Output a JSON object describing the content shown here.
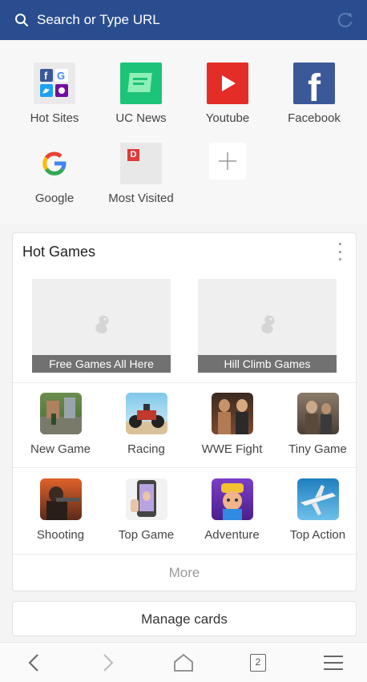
{
  "topbar": {
    "placeholder": "Search or Type URL",
    "search_icon": "search-icon",
    "refresh_icon": "refresh-icon"
  },
  "speed_dial": [
    {
      "label": "Hot Sites",
      "icon": "hot-sites-icon"
    },
    {
      "label": "UC News",
      "icon": "uc-news-icon"
    },
    {
      "label": "Youtube",
      "icon": "youtube-icon"
    },
    {
      "label": "Facebook",
      "icon": "facebook-icon"
    },
    {
      "label": "Google",
      "icon": "google-icon"
    },
    {
      "label": "Most Visited",
      "icon": "most-visited-icon",
      "badge": "D"
    },
    {
      "label": "",
      "icon": "add-icon"
    }
  ],
  "hot_games": {
    "title": "Hot Games",
    "banners": [
      "Free Games All Here",
      "Hill Climb Games"
    ],
    "games": [
      {
        "label": "New Game",
        "icon": "new-game-icon"
      },
      {
        "label": "Racing",
        "icon": "racing-icon"
      },
      {
        "label": "WWE Fight",
        "icon": "wwe-fight-icon"
      },
      {
        "label": "Tiny Game",
        "icon": "tiny-game-icon"
      },
      {
        "label": "Shooting",
        "icon": "shooting-icon"
      },
      {
        "label": "Top Game",
        "icon": "top-game-icon"
      },
      {
        "label": "Adventure",
        "icon": "adventure-icon"
      },
      {
        "label": "Top Action",
        "icon": "top-action-icon"
      }
    ],
    "more_label": "More"
  },
  "manage_cards": {
    "label": "Manage cards"
  },
  "bottom_nav": {
    "tab_count": "2"
  },
  "colors": {
    "topbar": "#2a4d8f",
    "youtube": "#e52d27",
    "facebook": "#3b5998",
    "uc_news": "#1ec37a"
  }
}
